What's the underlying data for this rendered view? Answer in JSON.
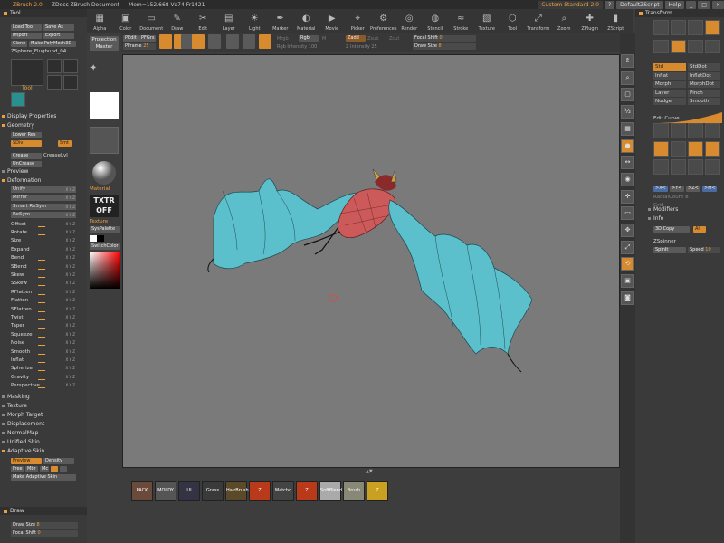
{
  "titlebar": {
    "app": "ZBrush 2.0",
    "doc": "ZDocs ZBrush Document",
    "mem": "Mem=152.668  Vx74  Fr1421",
    "menu_label": "Custom Standard 2.0",
    "script": "DefaultZScript",
    "help": "Help"
  },
  "palettes": [
    "Alpha",
    "Color",
    "Document",
    "Draw",
    "Edit",
    "Layer",
    "Light",
    "Marker",
    "Material",
    "Movie",
    "Picker",
    "Preferences",
    "Render",
    "Stencil",
    "Stroke",
    "Texture",
    "Tool",
    "Transform",
    "Zoom",
    "ZPlugin",
    "ZScript"
  ],
  "left": {
    "tool_header": "Tool",
    "load_tool": "Load Tool",
    "save_as": "Save As",
    "import": "Import",
    "export": "Export",
    "clone": "Clone",
    "make_polymesh": "Make PolyMesh3D",
    "tool_name": "ZSphere_Flughund_04",
    "tool_label": "Tool",
    "sections": {
      "display_properties": "Display Properties",
      "geometry": "Geometry",
      "lower_res": "Lower Res",
      "div": "SDiv",
      "smt": "Smt",
      "crease": "Crease",
      "crease_lvl": "CreaseLvl",
      "uncrease": "UnCrease",
      "preview": "Preview",
      "deformation": "Deformation",
      "masking": "Masking",
      "texture": "Texture",
      "morph_target": "Morph Target",
      "displacement": "Displacement",
      "normalmap": "NormalMap",
      "unified_skin": "Unified Skin",
      "adaptive_skin": "Adaptive Skin"
    },
    "deform_items": [
      "Unify",
      "Mirror",
      "Smart ReSym",
      "ReSym",
      "Offset",
      "Rotate",
      "Size",
      "Expand",
      "Bend",
      "SBend",
      "Skew",
      "SSkew",
      "RFlatten",
      "Flatten",
      "SFlatten",
      "Twist",
      "Taper",
      "Squeeze",
      "Noise",
      "Smooth",
      "Inflat",
      "Spherize",
      "Gravity",
      "Perspective"
    ],
    "xyz": "X Y Z",
    "adaptive": {
      "preview": "Preview",
      "density": "Density",
      "free": "Free",
      "mbr": "Mbr",
      "mc": "Mc",
      "make": "Make Adaptive Skin"
    },
    "draw_header": "Draw",
    "draw_size": "Draw Size",
    "draw_size_val": "8",
    "focal_shift": "Focal Shift",
    "focal_shift_val": "0"
  },
  "col2": {
    "projection_master": "Projection Master",
    "material_label": "Material",
    "txtr_off": "TXTR OFF",
    "texture_label": "Texture",
    "syspalette": "SysPalette",
    "switchcolor": "SwitchColor"
  },
  "shelf": {
    "edit": "Edit",
    "draw": "Draw",
    "move": "Move",
    "scale": "Scale",
    "rotate": "Rotate",
    "mrgb": "Mrgb",
    "rgb": "Rgb",
    "m": "M",
    "zadd": "Zadd",
    "zsub": "Zsub",
    "zcut": "Zcut",
    "rgb_intensity": "Rgb Intensity",
    "rgb_intensity_val": "100",
    "z_intensity": "Z Intensity",
    "z_intensity_val": "25",
    "focal_shift": "Focal Shift",
    "focal_shift_val": "0",
    "draw_size": "Draw Size",
    "draw_size_val": "8",
    "pframe": "PFrame",
    "pframe_val": "25",
    "pedit": "PEdit",
    "pfgrs": "PFGrs",
    "perspective_icon": "Persp"
  },
  "right_side": [
    "Scroll",
    "Zoom",
    "Actual",
    "AAHalf",
    "PF Sel",
    "Draw",
    "LSym",
    "Local",
    "Xyz",
    "Frame",
    "Move",
    "Scale",
    "Rotate",
    "Snapshot",
    "Camera"
  ],
  "right": {
    "header": "Transform",
    "buttons_top": [
      "Draw",
      "Move",
      "Scale",
      "Rotate"
    ],
    "list": [
      [
        "Std",
        "StdDot"
      ],
      [
        "Inflat",
        "InflatDot"
      ],
      [
        "Morph",
        "MorphDot"
      ],
      [
        "Layer",
        "Pinch"
      ],
      [
        "Nudge",
        "Smooth"
      ]
    ],
    "edit_curve": "Edit Curve",
    "x_label": ">X<",
    "y_label": ">Y<",
    "z_label": ">Z<",
    "m_label": ">M<",
    "radialcount": "RadialCount",
    "radialcount_val": "8",
    "grid": "Grid",
    "modifiers": "Modifiers",
    "info": "Info",
    "zsphere_label": "ZSpinner",
    "spinit": "SpinIt",
    "speed": "Speed",
    "speed_val": "10",
    "ai": "AI",
    "3d_copy": "3D Copy"
  },
  "bottom_items": [
    "PACK",
    "MOLDY",
    "UI",
    "Grass",
    "HairBrush",
    "Z",
    "Matcho",
    "Z",
    "SoftBlend",
    "Brush",
    "Z"
  ],
  "colors": {
    "accent": "#e8a040",
    "wing": "#5cc0cc",
    "body": "#cc5a5a"
  }
}
